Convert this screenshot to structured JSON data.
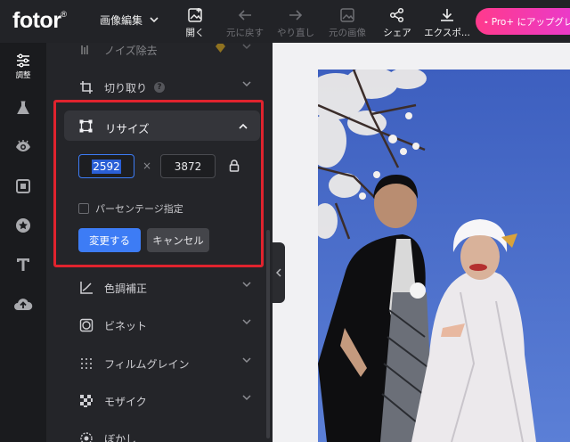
{
  "app": {
    "logo": "fotor",
    "logo_mark": "®",
    "menu_dropdown": "画像編集"
  },
  "toolbar": {
    "open": "開く",
    "undo": "元に戻す",
    "redo": "やり直し",
    "original": "元の画像",
    "share": "シェア",
    "export": "エクスポ...",
    "pro_button": "Pro+ にアップグレー"
  },
  "rail": {
    "items": [
      {
        "icon": "sliders-icon",
        "label": "調整",
        "active": true
      },
      {
        "icon": "flask-icon",
        "label": ""
      },
      {
        "icon": "eye-icon",
        "label": ""
      },
      {
        "icon": "frame-icon",
        "label": ""
      },
      {
        "icon": "sticker-icon",
        "label": ""
      },
      {
        "icon": "text-icon",
        "label": ""
      },
      {
        "icon": "upload-cloud-icon",
        "label": ""
      }
    ]
  },
  "panel": {
    "noise_reduction": "ノイズ除去",
    "crop": "切り取り",
    "resize": {
      "title": "リサイズ",
      "width": "2592",
      "height": "3872",
      "times": "×",
      "percentage_label": "パーセンテージ指定",
      "apply": "変更する",
      "cancel": "キャンセル"
    },
    "color_correction": "色調補正",
    "vignette": "ビネット",
    "film_grain": "フィルムグレイン",
    "mosaic": "モザイク",
    "blur": "ぼかし"
  },
  "colors": {
    "accent": "#3d7cf5",
    "highlight": "#e0232e",
    "pro_start": "#ff3a8c",
    "pro_end": "#e83ad0"
  }
}
